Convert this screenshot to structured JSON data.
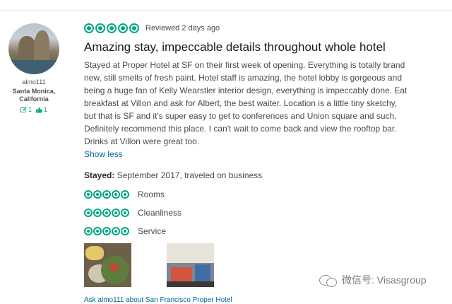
{
  "reviewer": {
    "username": "almo111",
    "location": "Santa Monica, California",
    "review_count": "1",
    "helpful_votes": "1"
  },
  "review": {
    "rating": 5,
    "reviewed_date": "Reviewed 2 days ago",
    "title": "Amazing stay, impeccable details throughout whole hotel",
    "body": "Stayed at Proper Hotel at SF on their first week of opening. Everything is totally brand new, still smells of fresh paint. Hotel staff is amazing, the hotel lobby is gorgeous and being a huge fan of Kelly Wearstler interior design, everything is impeccably done. Eat breakfast at Villon and ask for Albert, the best waiter. Location is a little tiny sketchy, but that is SF and it's super easy to get to conferences and Union square and such. Definitely recommend this place. I can't wait to come back and view the rooftop bar. Drinks at Villon were great too.",
    "show_less_label": "Show less",
    "stayed_label": "Stayed:",
    "stayed_value": "September 2017, traveled on business",
    "sub_ratings": [
      {
        "label": "Rooms",
        "rating": 5
      },
      {
        "label": "Cleanliness",
        "rating": 5
      },
      {
        "label": "Service",
        "rating": 5
      }
    ],
    "ask_link": "Ask almo111 about San Francisco Proper Hotel"
  },
  "watermark": {
    "text": "微信号: Visasgroup",
    "icon": "wechat-icon"
  },
  "colors": {
    "accent": "#00a680",
    "link": "#006699",
    "text": "#4a4a4a",
    "title": "#1a1a1a"
  }
}
